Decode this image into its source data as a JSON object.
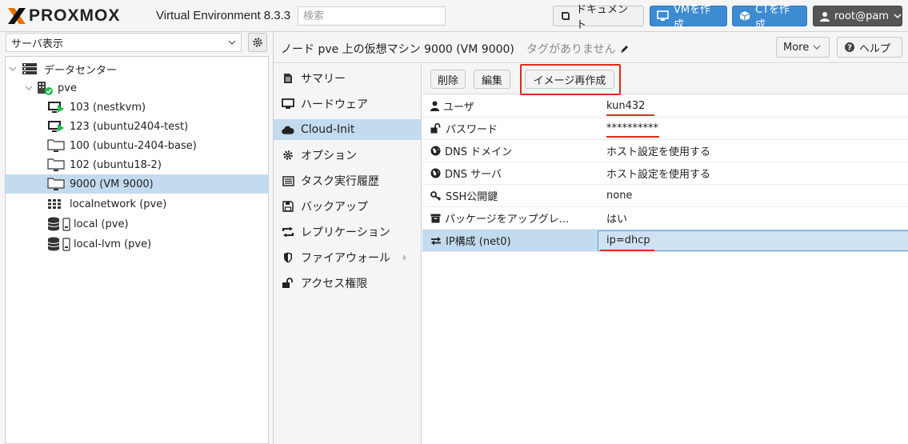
{
  "app": {
    "brand": "PROXMOX",
    "version_label": "Virtual Environment 8.3.3",
    "search_placeholder": "検索",
    "buttons": {
      "docs": "ドキュメント",
      "create_vm": "VMを作成",
      "create_ct": "CTを作成",
      "user": "root@pam"
    }
  },
  "sidebar": {
    "view_label": "サーバ表示",
    "tree": [
      {
        "label": "データセンター",
        "icon": "datacenter-icon"
      },
      {
        "label": "pve",
        "icon": "node-icon"
      },
      {
        "label": "103 (nestkvm)",
        "icon": "vm-running-icon"
      },
      {
        "label": "123 (ubuntu2404-test)",
        "icon": "vm-running-icon"
      },
      {
        "label": "100 (ubuntu-2404-base)",
        "icon": "template-icon"
      },
      {
        "label": "102 (ubuntu18-2)",
        "icon": "template-icon"
      },
      {
        "label": "9000 (VM 9000)",
        "icon": "template-icon"
      },
      {
        "label": "localnetwork (pve)",
        "icon": "network-icon"
      },
      {
        "label": "local (pve)",
        "icon": "storage-icon"
      },
      {
        "label": "local-lvm (pve)",
        "icon": "storage-icon"
      }
    ]
  },
  "main": {
    "title": "ノード pve 上の仮想マシン 9000 (VM 9000)",
    "tags": "タグがありません",
    "more_label": "More",
    "help_label": "ヘルプ",
    "nav": [
      {
        "label": "サマリー",
        "icon": "summary-icon"
      },
      {
        "label": "ハードウェア",
        "icon": "monitor-icon"
      },
      {
        "label": "Cloud-Init",
        "icon": "cloud-icon"
      },
      {
        "label": "オプション",
        "icon": "gear-icon"
      },
      {
        "label": "タスク実行履歴",
        "icon": "list-icon"
      },
      {
        "label": "バックアップ",
        "icon": "floppy-icon"
      },
      {
        "label": "レプリケーション",
        "icon": "replication-icon"
      },
      {
        "label": "ファイアウォール",
        "icon": "shield-icon"
      },
      {
        "label": "アクセス権限",
        "icon": "unlock-icon"
      }
    ],
    "toolbar": {
      "delete": "削除",
      "edit": "編集",
      "regenerate": "イメージ再作成"
    },
    "props": [
      {
        "key": "ユーザ",
        "value": "kun432",
        "icon": "user-icon"
      },
      {
        "key": "パスワード",
        "value": "**********",
        "icon": "unlock-icon"
      },
      {
        "key": "DNS ドメイン",
        "value": "ホスト設定を使用する",
        "icon": "globe-icon"
      },
      {
        "key": "DNS サーバ",
        "value": "ホスト設定を使用する",
        "icon": "globe-icon"
      },
      {
        "key": "SSH公開鍵",
        "value": "none",
        "icon": "key-icon"
      },
      {
        "key": "パッケージをアップグレ...",
        "value": "はい",
        "icon": "archive-icon"
      },
      {
        "key": "IP構成 (net0)",
        "value": "ip=dhcp",
        "icon": "exchange-icon"
      }
    ]
  }
}
